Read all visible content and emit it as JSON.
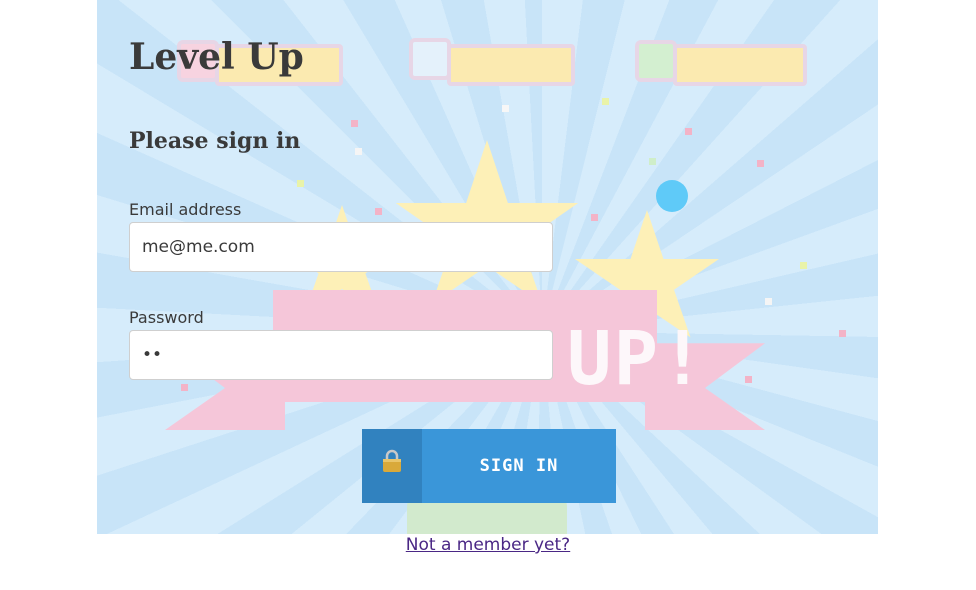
{
  "app": {
    "title": "Level Up"
  },
  "form": {
    "heading": "Please sign in",
    "email": {
      "label": "Email address",
      "value": "me@me.com"
    },
    "password": {
      "label": "Password",
      "value": "••"
    }
  },
  "button": {
    "label": "SIGN IN",
    "icon": "padlock-icon"
  },
  "link": {
    "label": "Not a member yet?"
  },
  "background": {
    "banner_text": "UP!"
  },
  "colors": {
    "button_icon_bg": "#3182bf",
    "button_bg": "#3a96d9",
    "link": "#4a2785",
    "cursor_dot": "#5fcaf8"
  }
}
